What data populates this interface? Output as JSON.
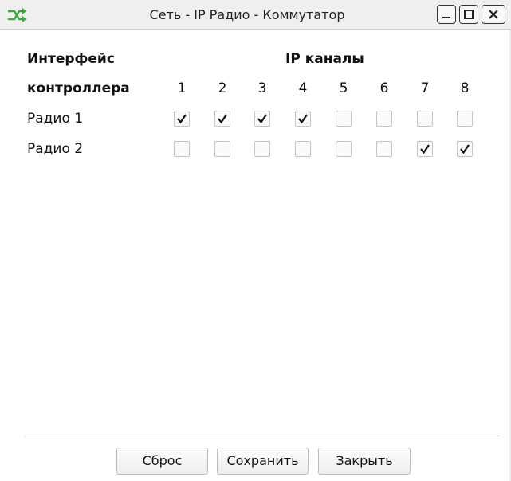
{
  "window": {
    "title": "Сеть - IP Радио - Коммутатор"
  },
  "header": {
    "interface_line1": "Интерфейс",
    "interface_line2": "контроллера",
    "channels_title": "IP каналы",
    "channel_numbers": [
      "1",
      "2",
      "3",
      "4",
      "5",
      "6",
      "7",
      "8"
    ]
  },
  "rows": [
    {
      "label": "Радио 1",
      "checked": [
        true,
        true,
        true,
        true,
        false,
        false,
        false,
        false
      ]
    },
    {
      "label": "Радио 2",
      "checked": [
        false,
        false,
        false,
        false,
        false,
        false,
        true,
        true
      ]
    }
  ],
  "buttons": {
    "reset": "Сброс",
    "save": "Сохранить",
    "close": "Закрыть"
  },
  "colors": {
    "icon_green": "#3ea83e"
  }
}
